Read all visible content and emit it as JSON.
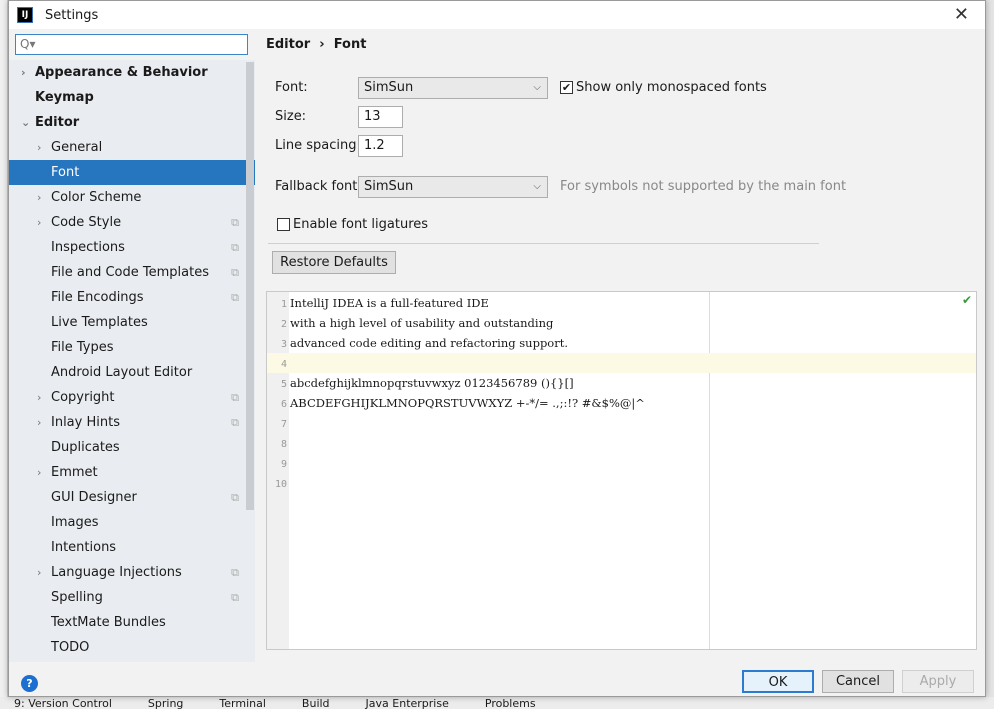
{
  "window": {
    "title": "Settings",
    "logo": "IJ"
  },
  "search": {
    "placeholder": "Q▾"
  },
  "sidebar": {
    "items": [
      {
        "label": "Appearance & Behavior",
        "level": 0,
        "bold": true,
        "arrow": "›"
      },
      {
        "label": "Keymap",
        "level": 0,
        "bold": true,
        "arrow": ""
      },
      {
        "label": "Editor",
        "level": 0,
        "bold": true,
        "arrow": "⌄"
      },
      {
        "label": "General",
        "level": 1,
        "arrow": "›"
      },
      {
        "label": "Font",
        "level": 1,
        "selected": true,
        "arrow": ""
      },
      {
        "label": "Color Scheme",
        "level": 1,
        "arrow": "›"
      },
      {
        "label": "Code Style",
        "level": 1,
        "arrow": "›",
        "copy": true
      },
      {
        "label": "Inspections",
        "level": 1,
        "arrow": "",
        "copy": true
      },
      {
        "label": "File and Code Templates",
        "level": 1,
        "arrow": "",
        "copy": true
      },
      {
        "label": "File Encodings",
        "level": 1,
        "arrow": "",
        "copy": true
      },
      {
        "label": "Live Templates",
        "level": 1,
        "arrow": ""
      },
      {
        "label": "File Types",
        "level": 1,
        "arrow": ""
      },
      {
        "label": "Android Layout Editor",
        "level": 1,
        "arrow": ""
      },
      {
        "label": "Copyright",
        "level": 1,
        "arrow": "›",
        "copy": true
      },
      {
        "label": "Inlay Hints",
        "level": 1,
        "arrow": "›",
        "copy": true
      },
      {
        "label": "Duplicates",
        "level": 1,
        "arrow": ""
      },
      {
        "label": "Emmet",
        "level": 1,
        "arrow": "›"
      },
      {
        "label": "GUI Designer",
        "level": 1,
        "arrow": "",
        "copy": true
      },
      {
        "label": "Images",
        "level": 1,
        "arrow": ""
      },
      {
        "label": "Intentions",
        "level": 1,
        "arrow": ""
      },
      {
        "label": "Language Injections",
        "level": 1,
        "arrow": "›",
        "copy": true
      },
      {
        "label": "Spelling",
        "level": 1,
        "arrow": "",
        "copy": true
      },
      {
        "label": "TextMate Bundles",
        "level": 1,
        "arrow": ""
      },
      {
        "label": "TODO",
        "level": 1,
        "arrow": ""
      }
    ]
  },
  "breadcrumb": {
    "parent": "Editor",
    "sep": "›",
    "current": "Font"
  },
  "form": {
    "font_label": "Font:",
    "font_value": "SimSun",
    "mono_label": "Show only monospaced fonts",
    "mono_checked": true,
    "size_label": "Size:",
    "size_value": "13",
    "spacing_label": "Line spacing:",
    "spacing_value": "1.2",
    "fallback_label": "Fallback font:",
    "fallback_value": "SimSun",
    "fallback_hint": "For symbols not supported by the main font",
    "ligatures_label": "Enable font ligatures",
    "ligatures_checked": false,
    "restore_label": "Restore Defaults"
  },
  "preview": {
    "lines": [
      "IntelliJ IDEA is a full-featured IDE",
      "with a high level of usability and outstanding",
      "advanced code editing and refactoring support.",
      "",
      "abcdefghijklmnopqrstuvwxyz 0123456789 (){}[]",
      "ABCDEFGHIJKLMNOPQRSTUVWXYZ +-*/= .,;:!? #&$%@|^",
      "",
      "",
      "",
      ""
    ],
    "current_line": 4
  },
  "buttons": {
    "ok": "OK",
    "cancel": "Cancel",
    "apply": "Apply",
    "help": "?"
  },
  "statusbar": [
    "9: Version Control",
    "Spring",
    "Terminal",
    "Build",
    "Java Enterprise",
    "Problems"
  ]
}
